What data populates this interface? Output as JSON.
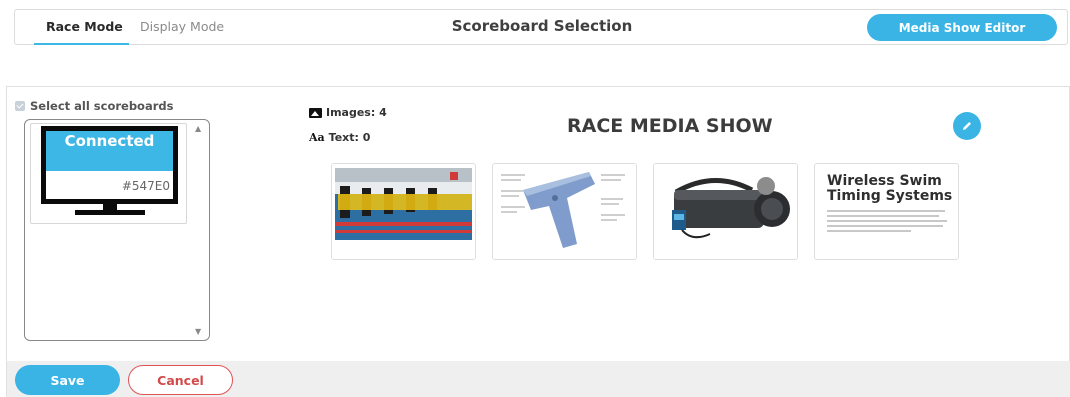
{
  "nav": {
    "tabs": [
      {
        "label": "Race Mode",
        "active": true
      },
      {
        "label": "Display Mode",
        "active": false
      }
    ],
    "title": "Scoreboard Selection",
    "editor_button": "Media Show Editor"
  },
  "scoreboards": {
    "select_all_label": "Select all scoreboards",
    "items": [
      {
        "status": "Connected",
        "id": "#547E0"
      }
    ]
  },
  "media_show": {
    "images_label": "Images: 4",
    "text_label": "Text: 0",
    "title": "RACE MEDIA SHOW",
    "slides": [
      {
        "kind": "image",
        "icon": "pool-start-blocks-photo"
      },
      {
        "kind": "image",
        "icon": "starter-gun-diagram"
      },
      {
        "kind": "image",
        "icon": "portable-speaker-photo"
      },
      {
        "kind": "image",
        "title": "Wireless Swim Timing Systems"
      }
    ]
  },
  "footer": {
    "save_label": "Save",
    "cancel_label": "Cancel"
  },
  "colors": {
    "accent": "#3ab4e4",
    "cancel": "#e05252",
    "footer_bg": "#efefef"
  }
}
